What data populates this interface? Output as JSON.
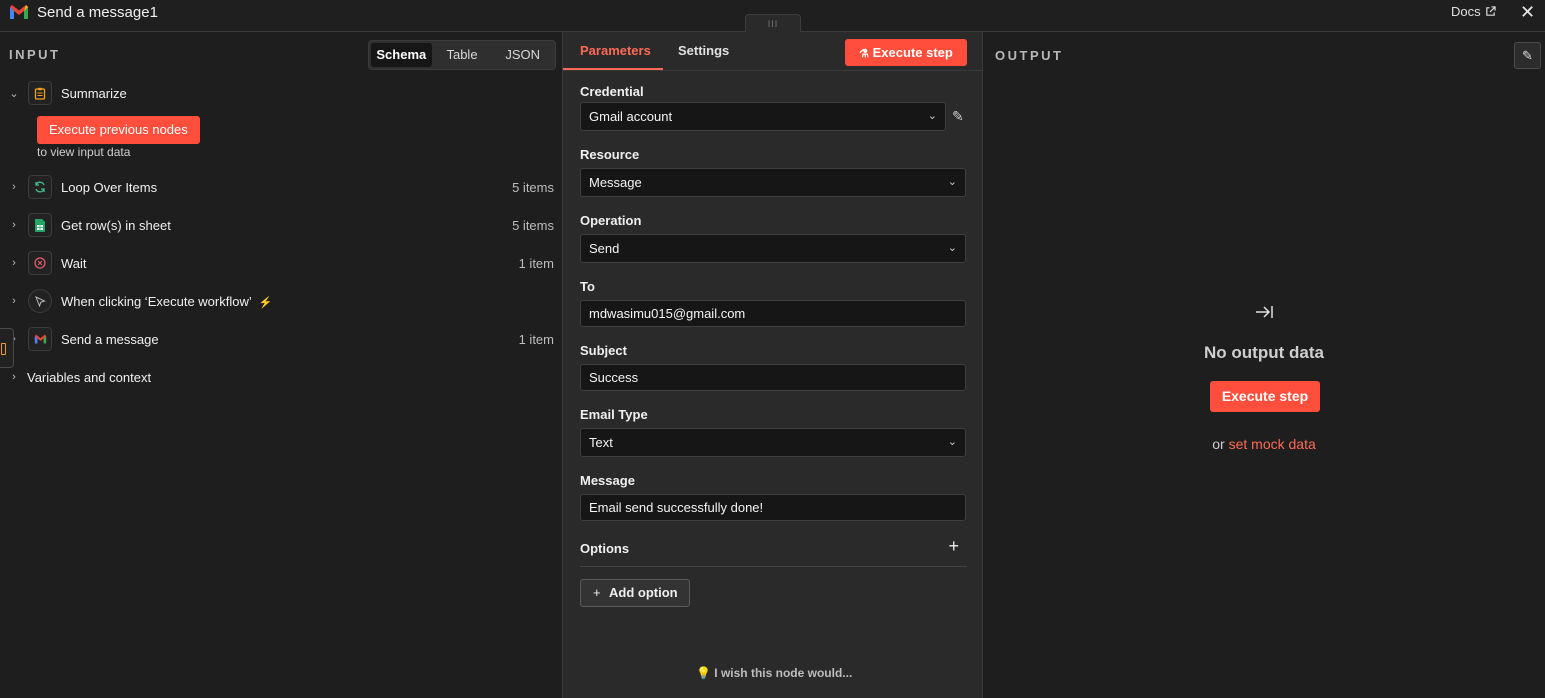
{
  "header": {
    "title": "Send a message1",
    "docs_label": "Docs",
    "drag_handle": "III"
  },
  "input": {
    "label": "INPUT",
    "view_tabs": [
      "Schema",
      "Table",
      "JSON"
    ],
    "active_view": "Schema",
    "execute_prev_label": "Execute previous nodes",
    "view_hint": "to view input data",
    "nodes": [
      {
        "name": "Summarize",
        "count": "",
        "icon": "clipboard-icon"
      },
      {
        "name": "Loop Over Items",
        "count": "5 items",
        "icon": "loop-icon"
      },
      {
        "name": "Get row(s) in sheet",
        "count": "5 items",
        "icon": "sheets-icon"
      },
      {
        "name": "Wait",
        "count": "1 item",
        "icon": "wait-icon"
      },
      {
        "name": "When clicking ‘Execute workflow’",
        "count": "",
        "icon": "cursor-icon"
      },
      {
        "name": "Send a message",
        "count": "1 item",
        "icon": "gmail-icon"
      }
    ],
    "variables_label": "Variables and context"
  },
  "parameters": {
    "tabs": [
      "Parameters",
      "Settings"
    ],
    "active_tab": "Parameters",
    "execute_label": "Execute step",
    "fields": {
      "credential": {
        "label": "Credential",
        "value": "Gmail account"
      },
      "resource": {
        "label": "Resource",
        "value": "Message"
      },
      "operation": {
        "label": "Operation",
        "value": "Send"
      },
      "to": {
        "label": "To",
        "value": "mdwasimu015@gmail.com"
      },
      "subject": {
        "label": "Subject",
        "value": "Success"
      },
      "email_type": {
        "label": "Email Type",
        "value": "Text"
      },
      "message": {
        "label": "Message",
        "value": "Email send successfully done!"
      }
    },
    "options_label": "Options",
    "add_option_label": "Add option",
    "wish_label": "I wish this node would..."
  },
  "output": {
    "label": "OUTPUT",
    "empty_title": "No output data",
    "execute_label": "Execute step",
    "mock_prefix": "or",
    "mock_link": "set mock data"
  },
  "colors": {
    "accent": "#ff4f3c",
    "accent_text": "#ff6a57",
    "background": "#1e1e1e",
    "panel": "#2a2a2a"
  }
}
